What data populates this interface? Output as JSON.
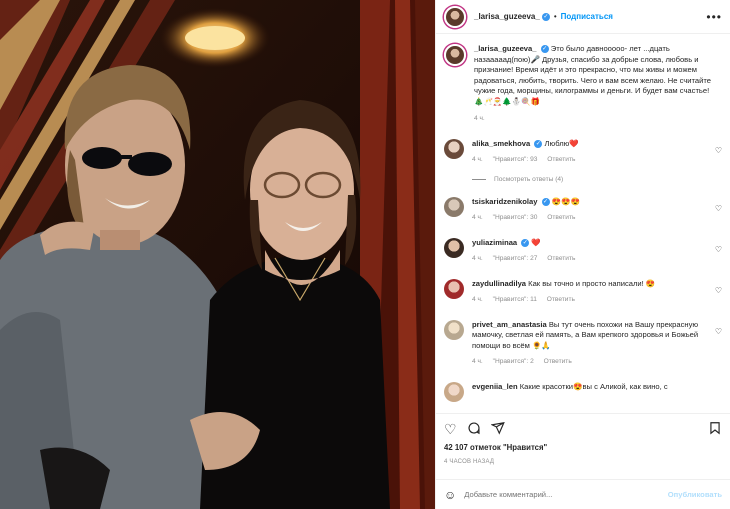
{
  "post": {
    "username": "_larisa_guzeeva_",
    "follow_label": "Подписаться",
    "separator": "•",
    "more_icon": "more-horizontal-icon"
  },
  "caption": {
    "username": "_larisa_guzeeva_",
    "text": "Это было давнооооо- лет ...дцать назааааад(пою)🎤 Друзья, спасибо за добрые слова, любовь и признание! Время идёт и это прекрасно, что мы живы и можем радоваться, любить, творить. Чего и вам всем желаю. Не считайте чужие года, морщины, килограммы и деньги. И будет вам счастье!🎄🥂🎅🌲⛄🍭🎁",
    "time": "4 ч."
  },
  "comments": [
    {
      "username": "alika_smekhova",
      "verified": true,
      "text": "Люблю❤️",
      "time": "4 ч.",
      "likes": "\"Нравится\": 93",
      "reply": "Ответить",
      "view_replies": "Посмотреть ответы (4)"
    },
    {
      "username": "tsiskaridzenikolay",
      "verified": true,
      "text": "😍😍😍",
      "time": "4 ч.",
      "likes": "\"Нравится\": 30",
      "reply": "Ответить"
    },
    {
      "username": "yuliaziminaa",
      "verified": true,
      "text": "❤️",
      "time": "4 ч.",
      "likes": "\"Нравится\": 27",
      "reply": "Ответить"
    },
    {
      "username": "zaydullinadilya",
      "verified": false,
      "text": "Как вы точно и просто написали! 😍",
      "time": "4 ч.",
      "likes": "\"Нравится\": 11",
      "reply": "Ответить"
    },
    {
      "username": "privet_am_anastasia",
      "verified": false,
      "text": "Вы тут очень похожи на Вашу прекрасную мамочку, светлая ей память, а Вам крепкого здоровья и Божьей помощи во всём 🌻🙏",
      "time": "4 ч.",
      "likes": "\"Нравится\": 2",
      "reply": "Ответить"
    },
    {
      "username": "evgeniia_len",
      "verified": false,
      "text": "Какие красотки😍вы с Аликой, как вино, с",
      "time": "",
      "likes": "",
      "reply": ""
    }
  ],
  "actions": {
    "like_icon": "heart-icon",
    "comment_icon": "comment-icon",
    "share_icon": "share-icon",
    "save_icon": "bookmark-icon"
  },
  "likes_text": "42 107 отметок \"Нравится\"",
  "date_text": "4 ЧАСОВ НАЗАД",
  "add_comment": {
    "placeholder": "Добавьте комментарий...",
    "post_label": "Опубликовать",
    "emoji_icon": "smile-icon"
  },
  "colors": {
    "link": "#0095f6",
    "verified": "#3897f0",
    "secondary": "#8e8e8e",
    "heart_red": "#ed4956"
  }
}
